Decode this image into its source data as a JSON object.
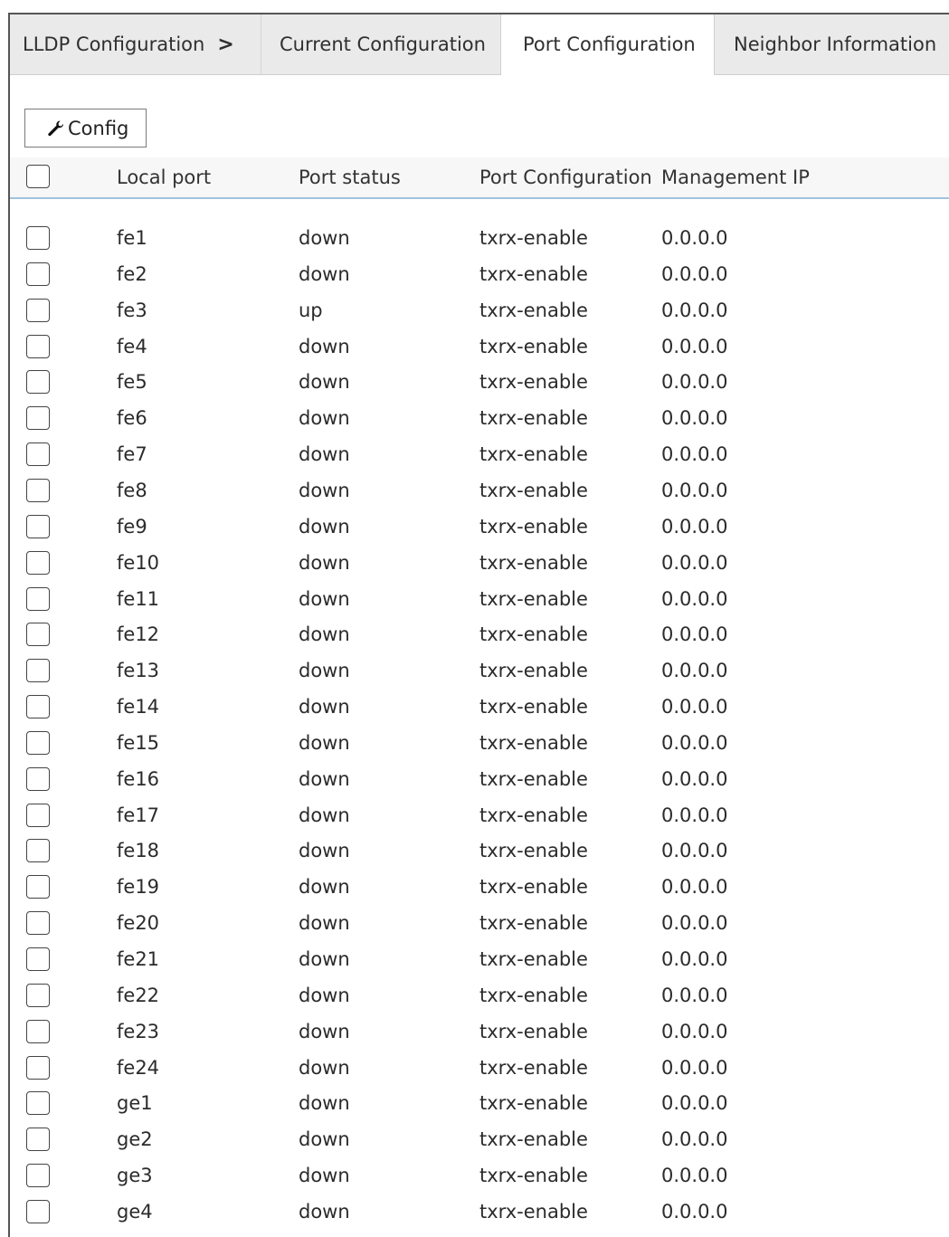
{
  "tabs": {
    "breadcrumb_label": "LLDP Configuration",
    "breadcrumb_sep": ">",
    "current_configuration": "Current Configuration",
    "port_configuration": "Port Configuration",
    "neighbor_information": "Neighbor Information",
    "active": "Port Configuration"
  },
  "toolbar": {
    "config_label": "Config",
    "config_icon": "wrench-icon"
  },
  "table": {
    "headers": {
      "local_port": "Local port",
      "port_status": "Port status",
      "port_configuration": "Port Configuration",
      "management_ip": "Management IP"
    },
    "rows": [
      {
        "port": "fe1",
        "status": "down",
        "config": "txrx-enable",
        "ip": "0.0.0.0"
      },
      {
        "port": "fe2",
        "status": "down",
        "config": "txrx-enable",
        "ip": "0.0.0.0"
      },
      {
        "port": "fe3",
        "status": "up",
        "config": "txrx-enable",
        "ip": "0.0.0.0"
      },
      {
        "port": "fe4",
        "status": "down",
        "config": "txrx-enable",
        "ip": "0.0.0.0"
      },
      {
        "port": "fe5",
        "status": "down",
        "config": "txrx-enable",
        "ip": "0.0.0.0"
      },
      {
        "port": "fe6",
        "status": "down",
        "config": "txrx-enable",
        "ip": "0.0.0.0"
      },
      {
        "port": "fe7",
        "status": "down",
        "config": "txrx-enable",
        "ip": "0.0.0.0"
      },
      {
        "port": "fe8",
        "status": "down",
        "config": "txrx-enable",
        "ip": "0.0.0.0"
      },
      {
        "port": "fe9",
        "status": "down",
        "config": "txrx-enable",
        "ip": "0.0.0.0"
      },
      {
        "port": "fe10",
        "status": "down",
        "config": "txrx-enable",
        "ip": "0.0.0.0"
      },
      {
        "port": "fe11",
        "status": "down",
        "config": "txrx-enable",
        "ip": "0.0.0.0"
      },
      {
        "port": "fe12",
        "status": "down",
        "config": "txrx-enable",
        "ip": "0.0.0.0"
      },
      {
        "port": "fe13",
        "status": "down",
        "config": "txrx-enable",
        "ip": "0.0.0.0"
      },
      {
        "port": "fe14",
        "status": "down",
        "config": "txrx-enable",
        "ip": "0.0.0.0"
      },
      {
        "port": "fe15",
        "status": "down",
        "config": "txrx-enable",
        "ip": "0.0.0.0"
      },
      {
        "port": "fe16",
        "status": "down",
        "config": "txrx-enable",
        "ip": "0.0.0.0"
      },
      {
        "port": "fe17",
        "status": "down",
        "config": "txrx-enable",
        "ip": "0.0.0.0"
      },
      {
        "port": "fe18",
        "status": "down",
        "config": "txrx-enable",
        "ip": "0.0.0.0"
      },
      {
        "port": "fe19",
        "status": "down",
        "config": "txrx-enable",
        "ip": "0.0.0.0"
      },
      {
        "port": "fe20",
        "status": "down",
        "config": "txrx-enable",
        "ip": "0.0.0.0"
      },
      {
        "port": "fe21",
        "status": "down",
        "config": "txrx-enable",
        "ip": "0.0.0.0"
      },
      {
        "port": "fe22",
        "status": "down",
        "config": "txrx-enable",
        "ip": "0.0.0.0"
      },
      {
        "port": "fe23",
        "status": "down",
        "config": "txrx-enable",
        "ip": "0.0.0.0"
      },
      {
        "port": "fe24",
        "status": "down",
        "config": "txrx-enable",
        "ip": "0.0.0.0"
      },
      {
        "port": "ge1",
        "status": "down",
        "config": "txrx-enable",
        "ip": "0.0.0.0"
      },
      {
        "port": "ge2",
        "status": "down",
        "config": "txrx-enable",
        "ip": "0.0.0.0"
      },
      {
        "port": "ge3",
        "status": "down",
        "config": "txrx-enable",
        "ip": "0.0.0.0"
      },
      {
        "port": "ge4",
        "status": "down",
        "config": "txrx-enable",
        "ip": "0.0.0.0"
      }
    ]
  }
}
